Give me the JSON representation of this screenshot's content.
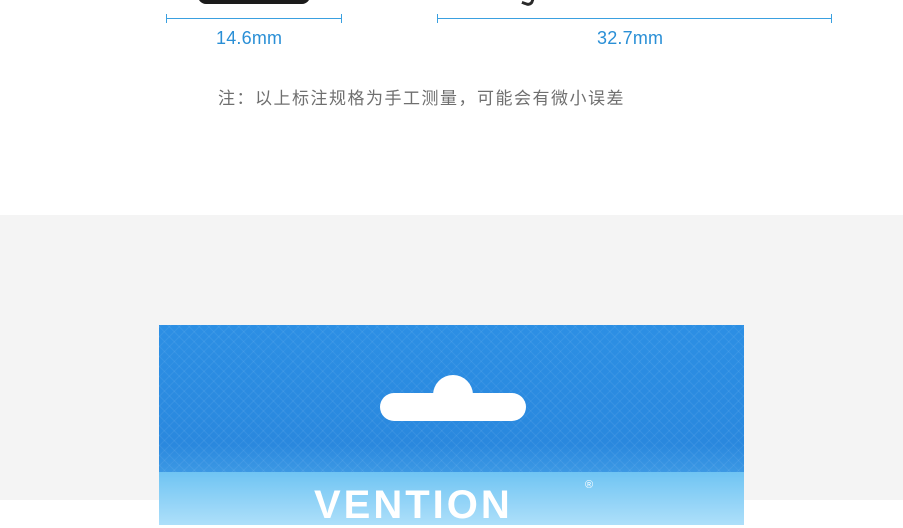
{
  "dimensions": {
    "width_label": "14.6mm",
    "length_label": "32.7mm",
    "line_color": "#3aa0e0",
    "text_color": "#2a8fd6"
  },
  "note": "注：以上标注规格为手工测量，可能会有微小误差",
  "package": {
    "brand": "VENTION",
    "registered_mark": "®",
    "color": "#2a88de"
  }
}
